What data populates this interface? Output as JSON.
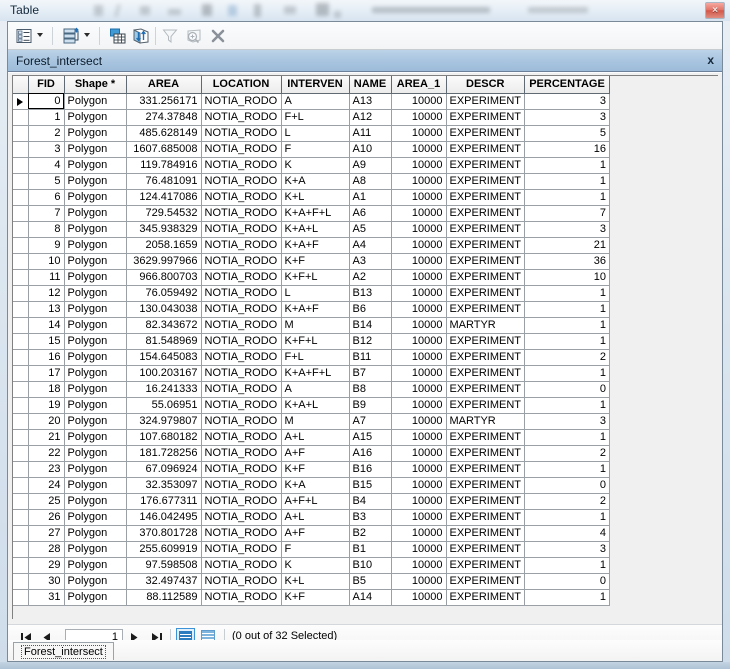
{
  "window": {
    "title": "Table",
    "close_label": "×"
  },
  "toolbar": {
    "buttons": [
      {
        "name": "table-options-button",
        "label": "Table Options"
      },
      {
        "name": "table-options-dropdown",
        "label": "Table Options menu"
      },
      {
        "name": "related-tables-button",
        "label": "Related Tables"
      },
      {
        "name": "related-tables-dropdown",
        "label": "Related Tables menu"
      },
      {
        "name": "select-by-attributes-button",
        "label": "Select By Attributes"
      },
      {
        "name": "switch-selection-button",
        "label": "Switch Selection"
      },
      {
        "name": "clear-selection-button",
        "label": "Clear Selection"
      },
      {
        "name": "zoom-to-selected-button",
        "label": "Zoom To Selected"
      },
      {
        "name": "delete-selection-button",
        "label": "Delete Selected Records"
      }
    ]
  },
  "table_title": {
    "label": "Forest_intersect",
    "close_label": "x"
  },
  "grid": {
    "columns": [
      {
        "key": "fid",
        "label": "FID",
        "align": "right"
      },
      {
        "key": "shape",
        "label": "Shape *",
        "align": "left"
      },
      {
        "key": "area",
        "label": "AREA",
        "align": "right"
      },
      {
        "key": "loc",
        "label": "LOCATION",
        "align": "left"
      },
      {
        "key": "int",
        "label": "INTERVEN",
        "align": "left"
      },
      {
        "key": "name",
        "label": "NAME",
        "align": "left"
      },
      {
        "key": "area1",
        "label": "AREA_1",
        "align": "right"
      },
      {
        "key": "descr",
        "label": "DESCR",
        "align": "left"
      },
      {
        "key": "pct",
        "label": "PERCENTAGE",
        "align": "right"
      }
    ],
    "current_row_index": 0,
    "rows": [
      [
        "0",
        "Polygon",
        "331.256171",
        "NOTIA_RODO",
        "A",
        "A13",
        "10000",
        "EXPERIMENT",
        "3"
      ],
      [
        "1",
        "Polygon",
        "274.37848",
        "NOTIA_RODO",
        "F+L",
        "A12",
        "10000",
        "EXPERIMENT",
        "3"
      ],
      [
        "2",
        "Polygon",
        "485.628149",
        "NOTIA_RODO",
        "L",
        "A11",
        "10000",
        "EXPERIMENT",
        "5"
      ],
      [
        "3",
        "Polygon",
        "1607.685008",
        "NOTIA_RODO",
        "F",
        "A10",
        "10000",
        "EXPERIMENT",
        "16"
      ],
      [
        "4",
        "Polygon",
        "119.784916",
        "NOTIA_RODO",
        "K",
        "A9",
        "10000",
        "EXPERIMENT",
        "1"
      ],
      [
        "5",
        "Polygon",
        "76.481091",
        "NOTIA_RODO",
        "K+A",
        "A8",
        "10000",
        "EXPERIMENT",
        "1"
      ],
      [
        "6",
        "Polygon",
        "124.417086",
        "NOTIA_RODO",
        "K+L",
        "A1",
        "10000",
        "EXPERIMENT",
        "1"
      ],
      [
        "7",
        "Polygon",
        "729.54532",
        "NOTIA_RODO",
        "K+A+F+L",
        "A6",
        "10000",
        "EXPERIMENT",
        "7"
      ],
      [
        "8",
        "Polygon",
        "345.938329",
        "NOTIA_RODO",
        "K+A+L",
        "A5",
        "10000",
        "EXPERIMENT",
        "3"
      ],
      [
        "9",
        "Polygon",
        "2058.1659",
        "NOTIA_RODO",
        "K+A+F",
        "A4",
        "10000",
        "EXPERIMENT",
        "21"
      ],
      [
        "10",
        "Polygon",
        "3629.997966",
        "NOTIA_RODO",
        "K+F",
        "A3",
        "10000",
        "EXPERIMENT",
        "36"
      ],
      [
        "11",
        "Polygon",
        "966.800703",
        "NOTIA_RODO",
        "K+F+L",
        "A2",
        "10000",
        "EXPERIMENT",
        "10"
      ],
      [
        "12",
        "Polygon",
        "76.059492",
        "NOTIA_RODO",
        "L",
        "B13",
        "10000",
        "EXPERIMENT",
        "1"
      ],
      [
        "13",
        "Polygon",
        "130.043038",
        "NOTIA_RODO",
        "K+A+F",
        "B6",
        "10000",
        "EXPERIMENT",
        "1"
      ],
      [
        "14",
        "Polygon",
        "82.343672",
        "NOTIA_RODO",
        "M",
        "B14",
        "10000",
        "MARTYR",
        "1"
      ],
      [
        "15",
        "Polygon",
        "81.548969",
        "NOTIA_RODO",
        "K+F+L",
        "B12",
        "10000",
        "EXPERIMENT",
        "1"
      ],
      [
        "16",
        "Polygon",
        "154.645083",
        "NOTIA_RODO",
        "F+L",
        "B11",
        "10000",
        "EXPERIMENT",
        "2"
      ],
      [
        "17",
        "Polygon",
        "100.203167",
        "NOTIA_RODO",
        "K+A+F+L",
        "B7",
        "10000",
        "EXPERIMENT",
        "1"
      ],
      [
        "18",
        "Polygon",
        "16.241333",
        "NOTIA_RODO",
        "A",
        "B8",
        "10000",
        "EXPERIMENT",
        "0"
      ],
      [
        "19",
        "Polygon",
        "55.06951",
        "NOTIA_RODO",
        "K+A+L",
        "B9",
        "10000",
        "EXPERIMENT",
        "1"
      ],
      [
        "20",
        "Polygon",
        "324.979807",
        "NOTIA_RODO",
        "M",
        "A7",
        "10000",
        "MARTYR",
        "3"
      ],
      [
        "21",
        "Polygon",
        "107.680182",
        "NOTIA_RODO",
        "A+L",
        "A15",
        "10000",
        "EXPERIMENT",
        "1"
      ],
      [
        "22",
        "Polygon",
        "181.728256",
        "NOTIA_RODO",
        "A+F",
        "A16",
        "10000",
        "EXPERIMENT",
        "2"
      ],
      [
        "23",
        "Polygon",
        "67.096924",
        "NOTIA_RODO",
        "K+F",
        "B16",
        "10000",
        "EXPERIMENT",
        "1"
      ],
      [
        "24",
        "Polygon",
        "32.353097",
        "NOTIA_RODO",
        "K+A",
        "B15",
        "10000",
        "EXPERIMENT",
        "0"
      ],
      [
        "25",
        "Polygon",
        "176.677311",
        "NOTIA_RODO",
        "A+F+L",
        "B4",
        "10000",
        "EXPERIMENT",
        "2"
      ],
      [
        "26",
        "Polygon",
        "146.042495",
        "NOTIA_RODO",
        "A+L",
        "B3",
        "10000",
        "EXPERIMENT",
        "1"
      ],
      [
        "27",
        "Polygon",
        "370.801728",
        "NOTIA_RODO",
        "A+F",
        "B2",
        "10000",
        "EXPERIMENT",
        "4"
      ],
      [
        "28",
        "Polygon",
        "255.609919",
        "NOTIA_RODO",
        "F",
        "B1",
        "10000",
        "EXPERIMENT",
        "3"
      ],
      [
        "29",
        "Polygon",
        "97.598508",
        "NOTIA_RODO",
        "K",
        "B10",
        "10000",
        "EXPERIMENT",
        "1"
      ],
      [
        "30",
        "Polygon",
        "32.497437",
        "NOTIA_RODO",
        "K+L",
        "B5",
        "10000",
        "EXPERIMENT",
        "0"
      ],
      [
        "31",
        "Polygon",
        "88.112589",
        "NOTIA_RODO",
        "K+F",
        "A14",
        "10000",
        "EXPERIMENT",
        "1"
      ]
    ]
  },
  "status_bar": {
    "page_value": "1",
    "first_label": "First record",
    "previous_label": "Previous record",
    "next_label": "Next record",
    "last_label": "Last record",
    "show_all_label": "Show all records",
    "show_selected_label": "Show selected records",
    "selection_text": "(0 out of 32 Selected)"
  },
  "tabs": [
    {
      "name": "tab-forest-intersect",
      "label": "Forest_intersect",
      "active": true
    }
  ],
  "colors": {
    "title_accent": "#a9c5e0",
    "close_red": "#d2584a",
    "highlight_blue": "#3c92d6"
  }
}
